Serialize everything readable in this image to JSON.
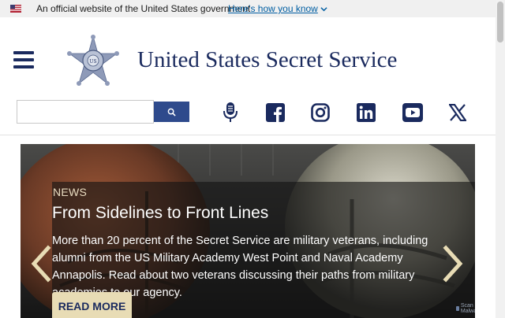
{
  "gov_banner": {
    "text": "An official website of the United States government",
    "link": "Here’s how you know"
  },
  "header": {
    "site_title": "United States Secret Service",
    "seal_text": "SECRET SERVICE"
  },
  "search": {
    "placeholder": ""
  },
  "social": [
    "microphone-icon",
    "facebook-icon",
    "instagram-icon",
    "linkedin-icon",
    "youtube-icon",
    "x-icon"
  ],
  "hero": {
    "label": "NEWS",
    "title": "From Sidelines to Front Lines",
    "description": "More than 20 percent of the Secret Service are military veterans, including alumni from the US Military Academy West Point and Naval Academy Annapolis. Read about two veterans discussing their paths from military academies to our agency.",
    "button": "READ MORE",
    "watermark": "Scan Malware"
  },
  "colors": {
    "navy": "#1a2a5e",
    "button_bg": "#e8dcb5",
    "search_button": "#2e4a8c"
  }
}
